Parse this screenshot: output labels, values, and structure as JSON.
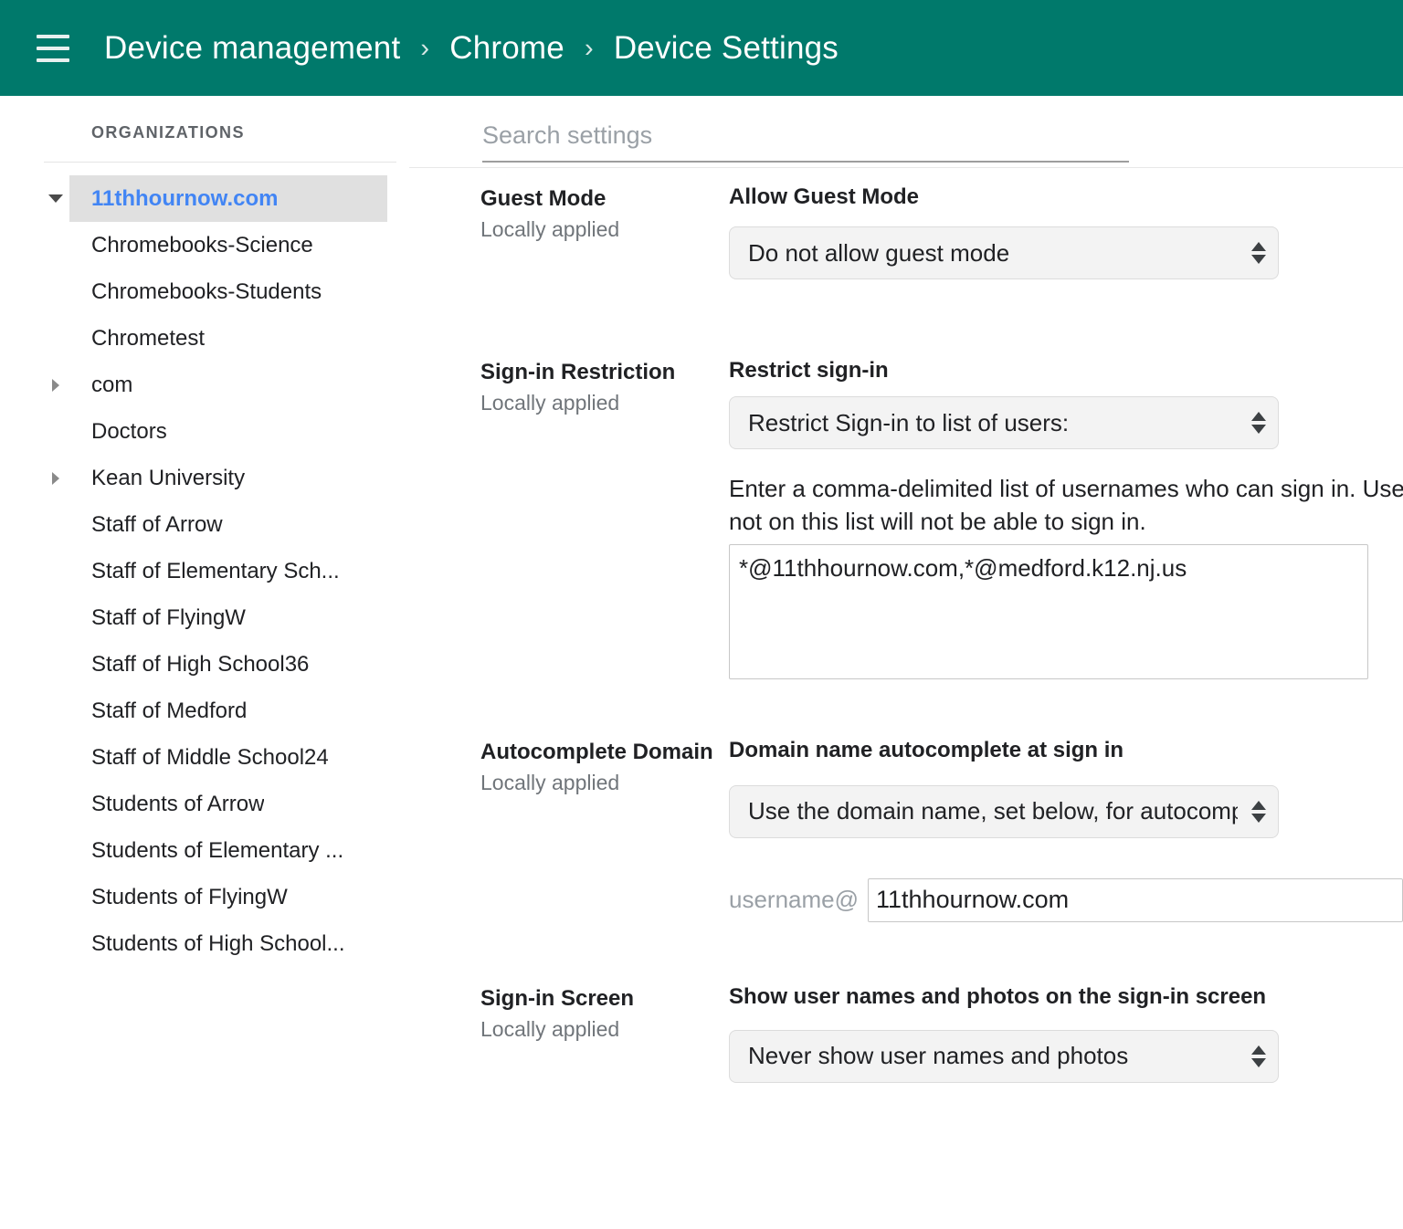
{
  "appbar": {
    "menu_icon": "hamburger-menu-icon",
    "breadcrumb": [
      {
        "label": "Device management"
      },
      {
        "label": "Chrome"
      },
      {
        "label": "Device Settings"
      }
    ],
    "separator": "›",
    "bg_color": "#00796b"
  },
  "sidebar": {
    "heading": "ORGANIZATIONS",
    "selected_color": "#4285f4",
    "selected_bg": "#e0e0e0",
    "items": [
      {
        "label": "11thhournow.com",
        "twisty": "expanded",
        "selected": true
      },
      {
        "label": "Chromebooks-Science",
        "twisty": "none",
        "selected": false
      },
      {
        "label": "Chromebooks-Students",
        "twisty": "none",
        "selected": false
      },
      {
        "label": "Chrometest",
        "twisty": "none",
        "selected": false
      },
      {
        "label": "com",
        "twisty": "collapsed",
        "selected": false
      },
      {
        "label": "Doctors",
        "twisty": "none",
        "selected": false
      },
      {
        "label": "Kean University",
        "twisty": "collapsed",
        "selected": false
      },
      {
        "label": "Staff of Arrow",
        "twisty": "none",
        "selected": false
      },
      {
        "label": "Staff of Elementary Sch...",
        "twisty": "none",
        "selected": false
      },
      {
        "label": "Staff of FlyingW",
        "twisty": "none",
        "selected": false
      },
      {
        "label": "Staff of High School36",
        "twisty": "none",
        "selected": false
      },
      {
        "label": "Staff of Medford",
        "twisty": "none",
        "selected": false
      },
      {
        "label": "Staff of Middle School24",
        "twisty": "none",
        "selected": false
      },
      {
        "label": "Students of Arrow",
        "twisty": "none",
        "selected": false
      },
      {
        "label": "Students of Elementary ...",
        "twisty": "none",
        "selected": false
      },
      {
        "label": "Students of FlyingW",
        "twisty": "none",
        "selected": false
      },
      {
        "label": "Students of High School...",
        "twisty": "none",
        "selected": false
      }
    ]
  },
  "search": {
    "placeholder": "Search settings",
    "value": ""
  },
  "sections": {
    "guest_mode": {
      "title": "Guest Mode",
      "subtitle": "Locally applied",
      "field_label": "Allow Guest Mode",
      "select_value": "Do not allow guest mode"
    },
    "signin_restriction": {
      "title": "Sign-in Restriction",
      "subtitle": "Locally applied",
      "field_label": "Restrict sign-in",
      "select_value": "Restrict Sign-in to list of users:",
      "description": "Enter a comma-delimited list of usernames who can sign in. Users not on this list will not be able to sign in.",
      "textarea_value": "*@11thhournow.com,*@medford.k12.nj.us"
    },
    "autocomplete_domain": {
      "title": "Autocomplete Domain",
      "subtitle": "Locally applied",
      "field_label": "Domain name autocomplete at sign in",
      "select_value": "Use the domain name, set below, for autocomplete",
      "username_prefix": "username@",
      "domain_value": "11thhournow.com"
    },
    "signin_screen": {
      "title": "Sign-in Screen",
      "subtitle": "Locally applied",
      "field_label": "Show user names and photos on the sign-in screen",
      "select_value": "Never show user names and photos"
    }
  }
}
